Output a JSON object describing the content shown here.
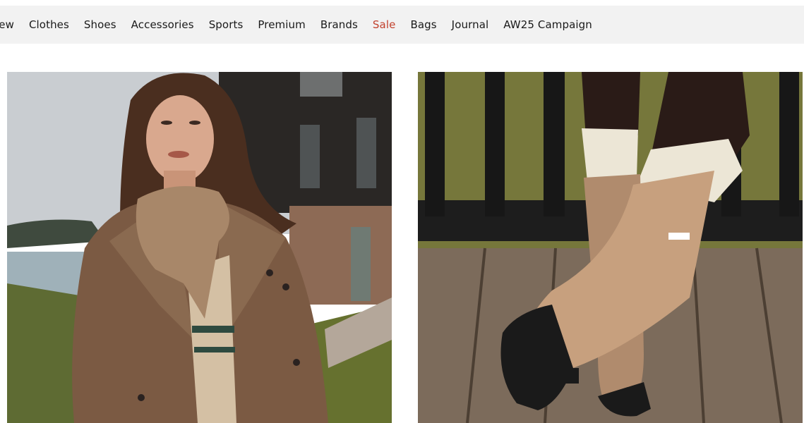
{
  "nav": {
    "items": [
      {
        "label": "New",
        "visible_text": "lew"
      },
      {
        "label": "Clothes"
      },
      {
        "label": "Shoes"
      },
      {
        "label": "Accessories"
      },
      {
        "label": "Sports"
      },
      {
        "label": "Premium"
      },
      {
        "label": "Brands"
      },
      {
        "label": "Sale",
        "accent": "#c2412d"
      },
      {
        "label": "Bags"
      },
      {
        "label": "Journal"
      },
      {
        "label": "AW25 Campaign"
      }
    ]
  },
  "tiles": [
    {
      "name": "woman-in-check-coat-image"
    },
    {
      "name": "tan-wellington-boots-image"
    }
  ],
  "colors": {
    "nav_background": "#f2f2f2",
    "text": "#1a1a1a",
    "sale": "#c2412d"
  }
}
